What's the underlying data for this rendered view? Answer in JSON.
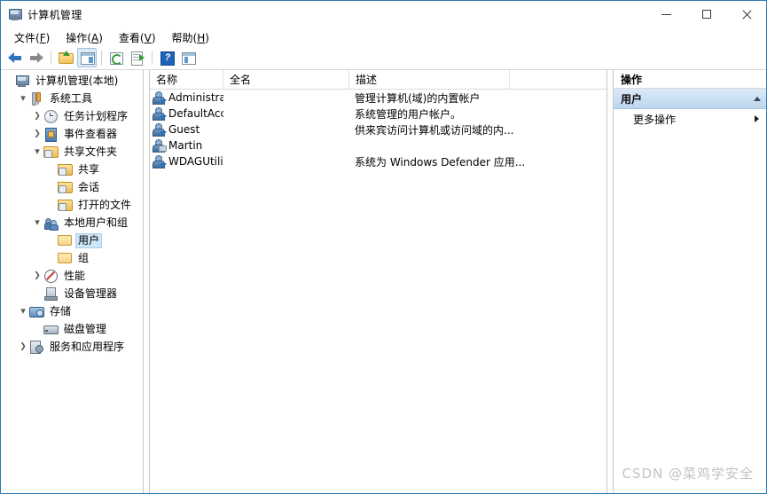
{
  "window": {
    "title": "计算机管理",
    "icon": "computer-management-icon",
    "minimize_label": "最小化",
    "maximize_label": "最大化",
    "close_label": "关闭"
  },
  "menubar": {
    "items": [
      {
        "text": "文件",
        "accel": "F"
      },
      {
        "text": "操作",
        "accel": "A"
      },
      {
        "text": "查看",
        "accel": "V"
      },
      {
        "text": "帮助",
        "accel": "H"
      }
    ]
  },
  "toolbar": {
    "buttons": [
      {
        "name": "back-button",
        "icon": "back-arrow-icon",
        "active": false
      },
      {
        "name": "forward-button",
        "icon": "forward-arrow-icon",
        "active": false
      },
      {
        "name": "up-one-level-button",
        "icon": "folder-up-icon",
        "active": false
      },
      {
        "name": "show-hide-console-tree-button",
        "icon": "console-tree-icon",
        "active": true
      },
      {
        "name": "refresh-button",
        "icon": "refresh-icon",
        "active": false
      },
      {
        "name": "export-list-button",
        "icon": "export-list-icon",
        "active": false
      },
      {
        "name": "help-button",
        "icon": "help-icon",
        "active": false
      },
      {
        "name": "show-action-pane-button",
        "icon": "action-pane-icon",
        "active": false
      }
    ]
  },
  "tree": {
    "nodes": [
      {
        "label": "计算机管理(本地)",
        "icon": "computer-icon",
        "indent": 0,
        "expander": "none",
        "selected": false
      },
      {
        "label": "系统工具",
        "icon": "tools-icon",
        "indent": 1,
        "expander": "open",
        "selected": false
      },
      {
        "label": "任务计划程序",
        "icon": "clock-icon",
        "indent": 2,
        "expander": "closed",
        "selected": false
      },
      {
        "label": "事件查看器",
        "icon": "event-viewer-icon",
        "indent": 2,
        "expander": "closed",
        "selected": false
      },
      {
        "label": "共享文件夹",
        "icon": "shared-folder-icon",
        "indent": 2,
        "expander": "open",
        "selected": false
      },
      {
        "label": "共享",
        "icon": "shared-folder-icon",
        "indent": 3,
        "expander": "none",
        "selected": false
      },
      {
        "label": "会话",
        "icon": "shared-folder-icon",
        "indent": 3,
        "expander": "none",
        "selected": false
      },
      {
        "label": "打开的文件",
        "icon": "shared-folder-icon",
        "indent": 3,
        "expander": "none",
        "selected": false
      },
      {
        "label": "本地用户和组",
        "icon": "local-users-groups-icon",
        "indent": 2,
        "expander": "open",
        "selected": false
      },
      {
        "label": "用户",
        "icon": "folder-icon",
        "indent": 3,
        "expander": "none",
        "selected": true
      },
      {
        "label": "组",
        "icon": "folder-icon",
        "indent": 3,
        "expander": "none",
        "selected": false
      },
      {
        "label": "性能",
        "icon": "performance-icon",
        "indent": 2,
        "expander": "closed",
        "selected": false
      },
      {
        "label": "设备管理器",
        "icon": "device-manager-icon",
        "indent": 2,
        "expander": "none",
        "selected": false
      },
      {
        "label": "存储",
        "icon": "storage-icon",
        "indent": 1,
        "expander": "open",
        "selected": false
      },
      {
        "label": "磁盘管理",
        "icon": "disk-management-icon",
        "indent": 2,
        "expander": "none",
        "selected": false
      },
      {
        "label": "服务和应用程序",
        "icon": "services-icon",
        "indent": 1,
        "expander": "closed",
        "selected": false
      }
    ]
  },
  "list": {
    "columns": [
      "名称",
      "全名",
      "描述"
    ],
    "rows": [
      {
        "name": "Administrat...",
        "full_name": "",
        "description": "管理计算机(域)的内置帐户",
        "icon": "user-disabled-icon"
      },
      {
        "name": "DefaultAcc...",
        "full_name": "",
        "description": "系统管理的用户帐户。",
        "icon": "user-disabled-icon"
      },
      {
        "name": "Guest",
        "full_name": "",
        "description": "供来宾访问计算机或访问域的内...",
        "icon": "user-disabled-icon"
      },
      {
        "name": "Martin",
        "full_name": "",
        "description": "",
        "icon": "user-icon"
      },
      {
        "name": "WDAGUtilit...",
        "full_name": "",
        "description": "系统为 Windows Defender 应用...",
        "icon": "user-disabled-icon"
      }
    ]
  },
  "actions": {
    "header": "操作",
    "section_title": "用户",
    "items": [
      {
        "label": "更多操作",
        "submenu": true
      }
    ]
  },
  "watermark": "CSDN @菜鸡学安全",
  "colors": {
    "window_border": "#2b7cb8",
    "selection": "#cde5f7",
    "action_section_top": "#dbe9f7",
    "action_section_bottom": "#bcd6ee",
    "watermark": "#c2c2c2"
  }
}
